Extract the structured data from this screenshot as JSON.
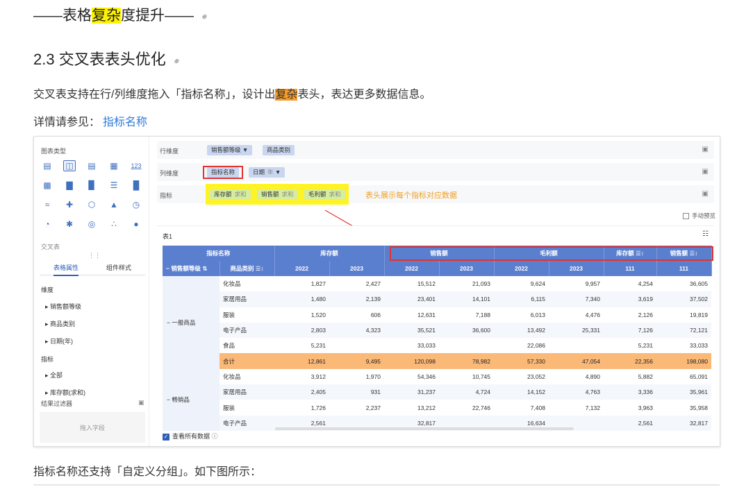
{
  "doc": {
    "title_prefix": "——表格",
    "title_hl": "复杂",
    "title_suffix": "度提升——",
    "h2": "2.3 交叉表表头优化",
    "p1_a": "交叉表支持在行/列维度拖入「指标名称」，设计出",
    "p1_hl": "复杂",
    "p1_b": "表头，表达更多数据信息。",
    "p2_label": "详情请参见：",
    "p2_link": "指标名称",
    "p3": "指标名称还支持「自定义分组」。如下图所示："
  },
  "left_panel": {
    "chart_type_label": "图表类型",
    "cross_table_label": "交叉表",
    "icon_123": "123",
    "tabs": [
      "表格属性",
      "组件样式"
    ],
    "section_dimension": "维度",
    "dims": [
      "销售额等级",
      "商品类别",
      "日期(年)"
    ],
    "section_metric": "指标",
    "metrics": [
      "全部",
      "库存额(求和)"
    ],
    "filter_label": "结果过滤器",
    "drop_hint": "拖入字段"
  },
  "config": {
    "row_label": "行维度",
    "row_chips": [
      "销售额等级",
      "商品类别"
    ],
    "col_label": "列维度",
    "col_chips": [
      "指标名称",
      "日期"
    ],
    "col_chip_sub": "年",
    "metric_label": "指标",
    "metric_chips": [
      {
        "name": "库存额",
        "agg": "求和"
      },
      {
        "name": "销售额",
        "agg": "求和"
      },
      {
        "name": "毛利额",
        "agg": "求和"
      }
    ],
    "annotation": "表头展示每个指标对应数据",
    "manual_preview": "手动预览"
  },
  "table": {
    "title": "表1",
    "header1": {
      "metric_name": "指标名称",
      "groups": [
        "库存额",
        "销售额",
        "毛利额"
      ],
      "stock_total": "库存额",
      "sales_total": "销售额"
    },
    "header2": {
      "sales_level": "销售额等级",
      "category": "商品类别",
      "years": [
        "2022",
        "2023",
        "2022",
        "2023",
        "2022",
        "2023"
      ],
      "t1": "111",
      "t2": "111"
    },
    "group1": "一般商品",
    "group2": "畅销品",
    "rows": [
      [
        "化妆品",
        "1,827",
        "2,427",
        "15,512",
        "21,093",
        "9,624",
        "9,957",
        "4,254",
        "36,605"
      ],
      [
        "家居用品",
        "1,480",
        "2,139",
        "23,401",
        "14,101",
        "6,115",
        "7,340",
        "3,619",
        "37,502"
      ],
      [
        "服装",
        "1,520",
        "606",
        "12,631",
        "7,188",
        "6,013",
        "4,476",
        "2,126",
        "19,819"
      ],
      [
        "电子产品",
        "2,803",
        "4,323",
        "35,521",
        "36,600",
        "13,492",
        "25,331",
        "7,126",
        "72,121"
      ],
      [
        "食品",
        "5,231",
        "",
        "33,033",
        "",
        "22,086",
        "",
        "5,231",
        "33,033"
      ],
      [
        "合计",
        "12,861",
        "9,495",
        "120,098",
        "78,982",
        "57,330",
        "47,054",
        "22,356",
        "198,080"
      ],
      [
        "化妆品",
        "3,912",
        "1,970",
        "54,346",
        "10,745",
        "23,052",
        "4,890",
        "5,882",
        "65,091"
      ],
      [
        "家居用品",
        "2,405",
        "931",
        "31,237",
        "4,724",
        "14,152",
        "4,763",
        "3,336",
        "35,961"
      ],
      [
        "服装",
        "1,726",
        "2,237",
        "13,212",
        "22,746",
        "7,408",
        "7,132",
        "3,963",
        "35,958"
      ],
      [
        "电子产品",
        "2,561",
        "",
        "32,817",
        "",
        "16,634",
        "",
        "2,561",
        "32,817"
      ]
    ],
    "view_all": "查看所有数据"
  }
}
